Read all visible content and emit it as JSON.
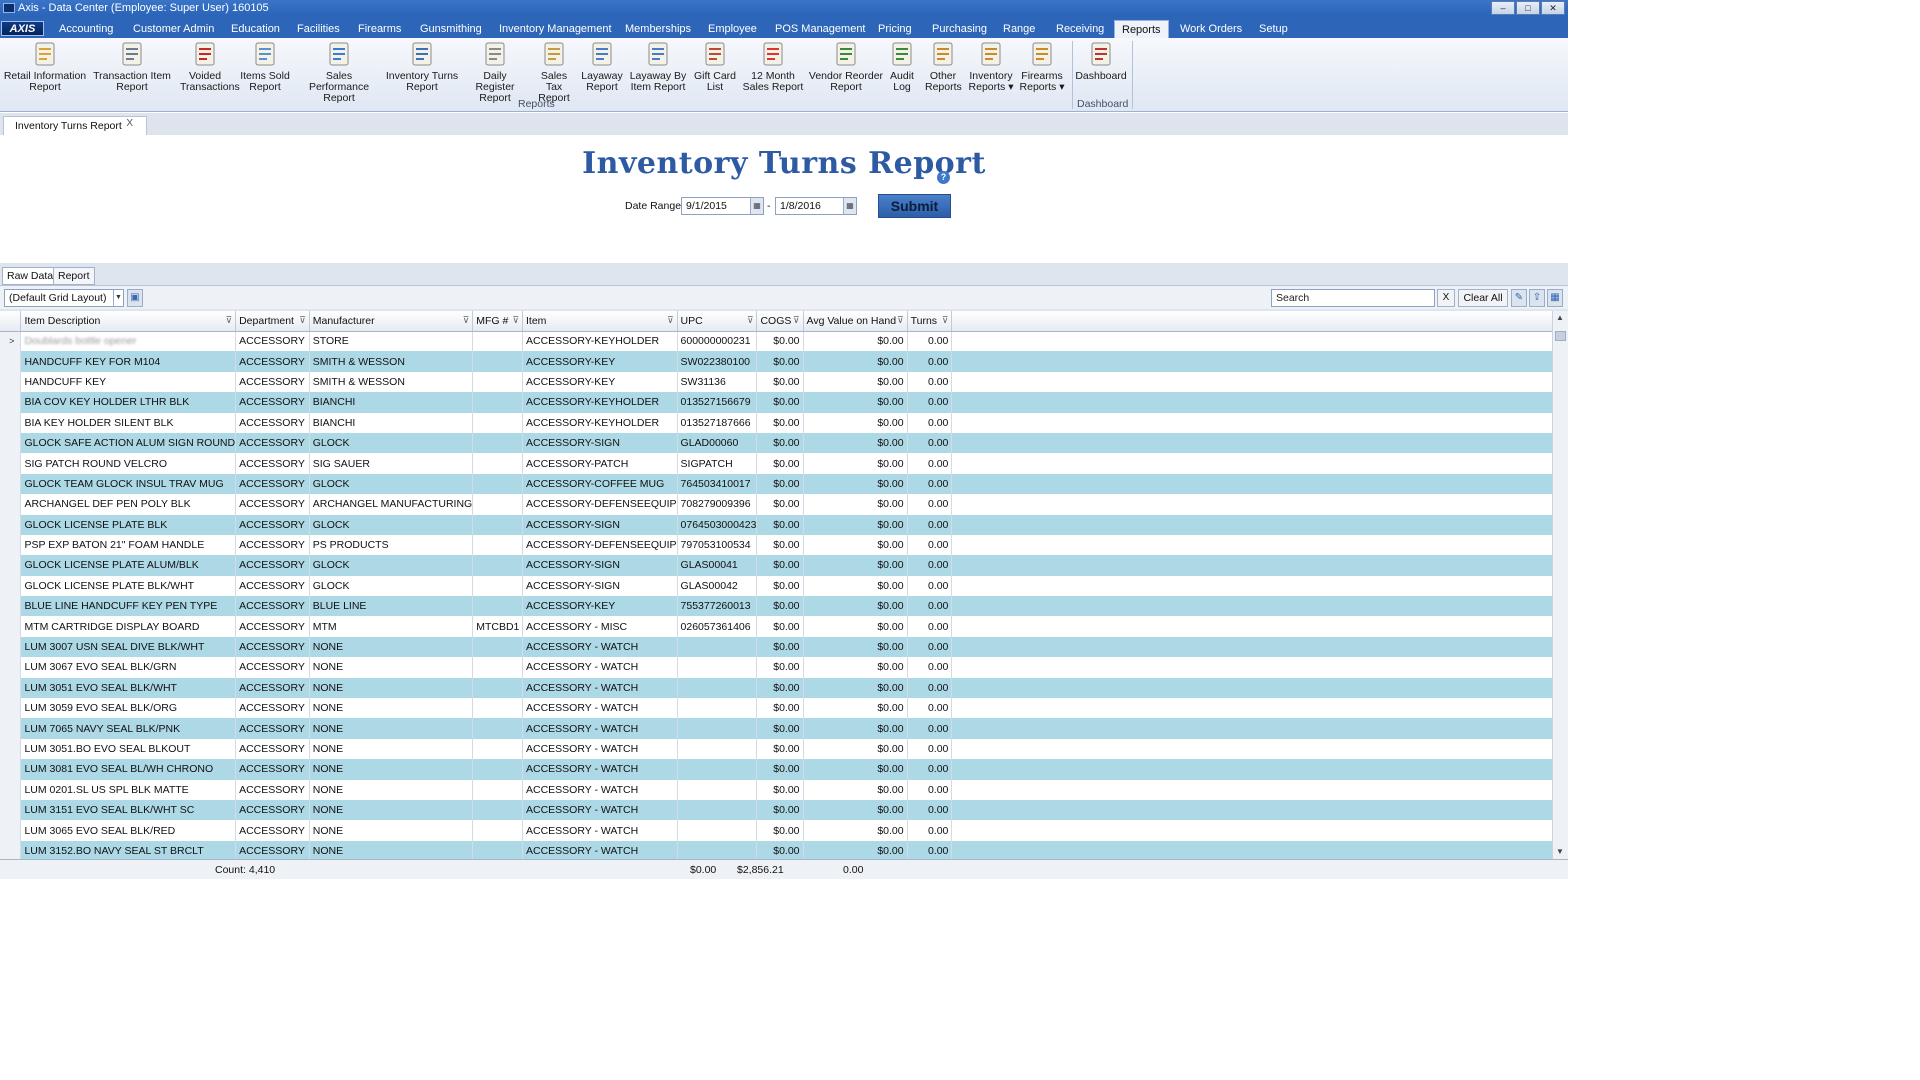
{
  "window": {
    "title": "Axis - Data Center  (Employee: Super User) 160105",
    "minimize": "–",
    "maximize": "□",
    "close": "✕"
  },
  "brand": "AXIS",
  "menu": [
    "Accounting",
    "Customer Admin",
    "Education",
    "Facilities",
    "Firearms",
    "Gunsmithing",
    "Inventory Management",
    "Memberships",
    "Employee",
    "POS Management",
    "Pricing",
    "Purchasing",
    "Range",
    "Receiving",
    "Reports",
    "Work Orders",
    "Setup"
  ],
  "active_menu": "Reports",
  "ribbon": {
    "items": [
      {
        "l1": "Retail Information",
        "l2": "Report",
        "icon": "report-icon"
      },
      {
        "l1": "Transaction Item",
        "l2": "Report",
        "icon": "pen-icon"
      },
      {
        "l1": "Voided",
        "l2": "Transactions",
        "icon": "void-icon"
      },
      {
        "l1": "Items Sold",
        "l2": "Report",
        "icon": "bar-chart-icon"
      },
      {
        "l1": "Sales Performance",
        "l2": "Report",
        "icon": "chart-icon"
      },
      {
        "l1": "Inventory Turns",
        "l2": "Report",
        "icon": "truck-icon"
      },
      {
        "l1": "Daily Register",
        "l2": "Report",
        "icon": "register-icon"
      },
      {
        "l1": "Sales Tax",
        "l2": "Report",
        "icon": "tax-icon"
      },
      {
        "l1": "Layaway",
        "l2": "Report",
        "icon": "layaway-icon"
      },
      {
        "l1": "Layaway By",
        "l2": "Item Report",
        "icon": "layaway-item-icon"
      },
      {
        "l1": "Gift Card",
        "l2": "List",
        "icon": "gift-card-icon"
      },
      {
        "l1": "12 Month",
        "l2": "Sales Report",
        "icon": "calendar-icon"
      },
      {
        "l1": "Vendor Reorder",
        "l2": "Report",
        "icon": "vendor-icon"
      },
      {
        "l1": "Audit",
        "l2": "Log",
        "icon": "audit-icon"
      },
      {
        "l1": "Other",
        "l2": "Reports",
        "icon": "other-reports-icon"
      },
      {
        "l1": "Inventory",
        "l2": "Reports ▾",
        "icon": "inventory-reports-icon"
      },
      {
        "l1": "Firearms",
        "l2": "Reports ▾",
        "icon": "firearms-reports-icon"
      },
      {
        "l1": "Dashboard",
        "l2": "",
        "icon": "dashboard-icon"
      }
    ],
    "group_reports": "Reports",
    "group_dashboard": "Dashboard"
  },
  "doc_tab": {
    "label": "Inventory Turns Report",
    "close": "X"
  },
  "report": {
    "title": "Inventory Turns Report",
    "help": "?",
    "date_range_label": "Date Range:",
    "date_from": "9/1/2015",
    "date_to": "1/8/2016",
    "dash": "-",
    "submit": "Submit"
  },
  "subtabs": [
    "Raw Data",
    "Report"
  ],
  "toolbar": {
    "layout": "(Default Grid Layout)",
    "search_placeholder": "Search",
    "search_clear": "X",
    "clear_all": "Clear All"
  },
  "grid": {
    "columns": [
      "Item Description",
      "Department",
      "Manufacturer",
      "MFG #",
      "Item",
      "UPC",
      "COGS",
      "Avg Value on Hand",
      "Turns"
    ],
    "rows": [
      [
        "Doublards bottle opener",
        "ACCESSORY",
        "STORE",
        "",
        "ACCESSORY-KEYHOLDER",
        "600000000231",
        "$0.00",
        "$0.00",
        "0.00"
      ],
      [
        "HANDCUFF KEY FOR M104",
        "ACCESSORY",
        "SMITH & WESSON",
        "",
        "ACCESSORY-KEY",
        "SW022380100",
        "$0.00",
        "$0.00",
        "0.00"
      ],
      [
        "HANDCUFF KEY",
        "ACCESSORY",
        "SMITH & WESSON",
        "",
        "ACCESSORY-KEY",
        "SW31136",
        "$0.00",
        "$0.00",
        "0.00"
      ],
      [
        "BIA COV KEY HOLDER LTHR BLK",
        "ACCESSORY",
        "BIANCHI",
        "",
        "ACCESSORY-KEYHOLDER",
        "013527156679",
        "$0.00",
        "$0.00",
        "0.00"
      ],
      [
        "BIA KEY HOLDER SILENT BLK",
        "ACCESSORY",
        "BIANCHI",
        "",
        "ACCESSORY-KEYHOLDER",
        "013527187666",
        "$0.00",
        "$0.00",
        "0.00"
      ],
      [
        "GLOCK SAFE ACTION ALUM SIGN ROUND",
        "ACCESSORY",
        "GLOCK",
        "",
        "ACCESSORY-SIGN",
        "GLAD00060",
        "$0.00",
        "$0.00",
        "0.00"
      ],
      [
        "SIG PATCH ROUND VELCRO",
        "ACCESSORY",
        "SIG SAUER",
        "",
        "ACCESSORY-PATCH",
        "SIGPATCH",
        "$0.00",
        "$0.00",
        "0.00"
      ],
      [
        "GLOCK TEAM GLOCK INSUL TRAV MUG",
        "ACCESSORY",
        "GLOCK",
        "",
        "ACCESSORY-COFFEE MUG",
        "764503410017",
        "$0.00",
        "$0.00",
        "0.00"
      ],
      [
        "ARCHANGEL DEF PEN POLY BLK",
        "ACCESSORY",
        "ARCHANGEL MANUFACTURING",
        "",
        "ACCESSORY-DEFENSEEQUIP",
        "708279009396",
        "$0.00",
        "$0.00",
        "0.00"
      ],
      [
        "GLOCK LICENSE PLATE BLK",
        "ACCESSORY",
        "GLOCK",
        "",
        "ACCESSORY-SIGN",
        "0764503000423",
        "$0.00",
        "$0.00",
        "0.00"
      ],
      [
        "PSP EXP BATON 21\" FOAM HANDLE",
        "ACCESSORY",
        "PS PRODUCTS",
        "",
        "ACCESSORY-DEFENSEEQUIP",
        "797053100534",
        "$0.00",
        "$0.00",
        "0.00"
      ],
      [
        "GLOCK LICENSE PLATE ALUM/BLK",
        "ACCESSORY",
        "GLOCK",
        "",
        "ACCESSORY-SIGN",
        "GLAS00041",
        "$0.00",
        "$0.00",
        "0.00"
      ],
      [
        "GLOCK LICENSE PLATE BLK/WHT",
        "ACCESSORY",
        "GLOCK",
        "",
        "ACCESSORY-SIGN",
        "GLAS00042",
        "$0.00",
        "$0.00",
        "0.00"
      ],
      [
        "BLUE LINE HANDCUFF KEY PEN TYPE",
        "ACCESSORY",
        "BLUE LINE",
        "",
        "ACCESSORY-KEY",
        "755377260013",
        "$0.00",
        "$0.00",
        "0.00"
      ],
      [
        "MTM CARTRIDGE DISPLAY BOARD",
        "ACCESSORY",
        "MTM",
        "MTCBD1",
        "ACCESSORY - MISC",
        "026057361406",
        "$0.00",
        "$0.00",
        "0.00"
      ],
      [
        "LUM 3007 USN SEAL DIVE BLK/WHT",
        "ACCESSORY",
        "NONE",
        "",
        "ACCESSORY - WATCH",
        "",
        "$0.00",
        "$0.00",
        "0.00"
      ],
      [
        "LUM 3067 EVO SEAL BLK/GRN",
        "ACCESSORY",
        "NONE",
        "",
        "ACCESSORY - WATCH",
        "",
        "$0.00",
        "$0.00",
        "0.00"
      ],
      [
        "LUM 3051 EVO SEAL BLK/WHT",
        "ACCESSORY",
        "NONE",
        "",
        "ACCESSORY - WATCH",
        "",
        "$0.00",
        "$0.00",
        "0.00"
      ],
      [
        "LUM 3059 EVO SEAL BLK/ORG",
        "ACCESSORY",
        "NONE",
        "",
        "ACCESSORY - WATCH",
        "",
        "$0.00",
        "$0.00",
        "0.00"
      ],
      [
        "LUM 7065 NAVY SEAL BLK/PNK",
        "ACCESSORY",
        "NONE",
        "",
        "ACCESSORY - WATCH",
        "",
        "$0.00",
        "$0.00",
        "0.00"
      ],
      [
        "LUM 3051.BO EVO SEAL BLKOUT",
        "ACCESSORY",
        "NONE",
        "",
        "ACCESSORY - WATCH",
        "",
        "$0.00",
        "$0.00",
        "0.00"
      ],
      [
        "LUM 3081 EVO SEAL BL/WH CHRONO",
        "ACCESSORY",
        "NONE",
        "",
        "ACCESSORY - WATCH",
        "",
        "$0.00",
        "$0.00",
        "0.00"
      ],
      [
        "LUM 0201.SL US SPL BLK MATTE",
        "ACCESSORY",
        "NONE",
        "",
        "ACCESSORY - WATCH",
        "",
        "$0.00",
        "$0.00",
        "0.00"
      ],
      [
        "LUM 3151 EVO SEAL BLK/WHT SC",
        "ACCESSORY",
        "NONE",
        "",
        "ACCESSORY - WATCH",
        "",
        "$0.00",
        "$0.00",
        "0.00"
      ],
      [
        "LUM 3065 EVO SEAL BLK/RED",
        "ACCESSORY",
        "NONE",
        "",
        "ACCESSORY - WATCH",
        "",
        "$0.00",
        "$0.00",
        "0.00"
      ],
      [
        "LUM 3152.BO NAVY SEAL ST BRCLT",
        "ACCESSORY",
        "NONE",
        "",
        "ACCESSORY - WATCH",
        "",
        "$0.00",
        "$0.00",
        "0.00"
      ]
    ],
    "row_indicator": ">",
    "footer": {
      "count": "Count: 4,410",
      "cogs": "$0.00",
      "avg_value": "$2,856.21",
      "turns": "0.00"
    }
  },
  "colors": {
    "accent": "#2d66b9",
    "row_alt": "#add8e6",
    "title": "#2e5aa3"
  }
}
